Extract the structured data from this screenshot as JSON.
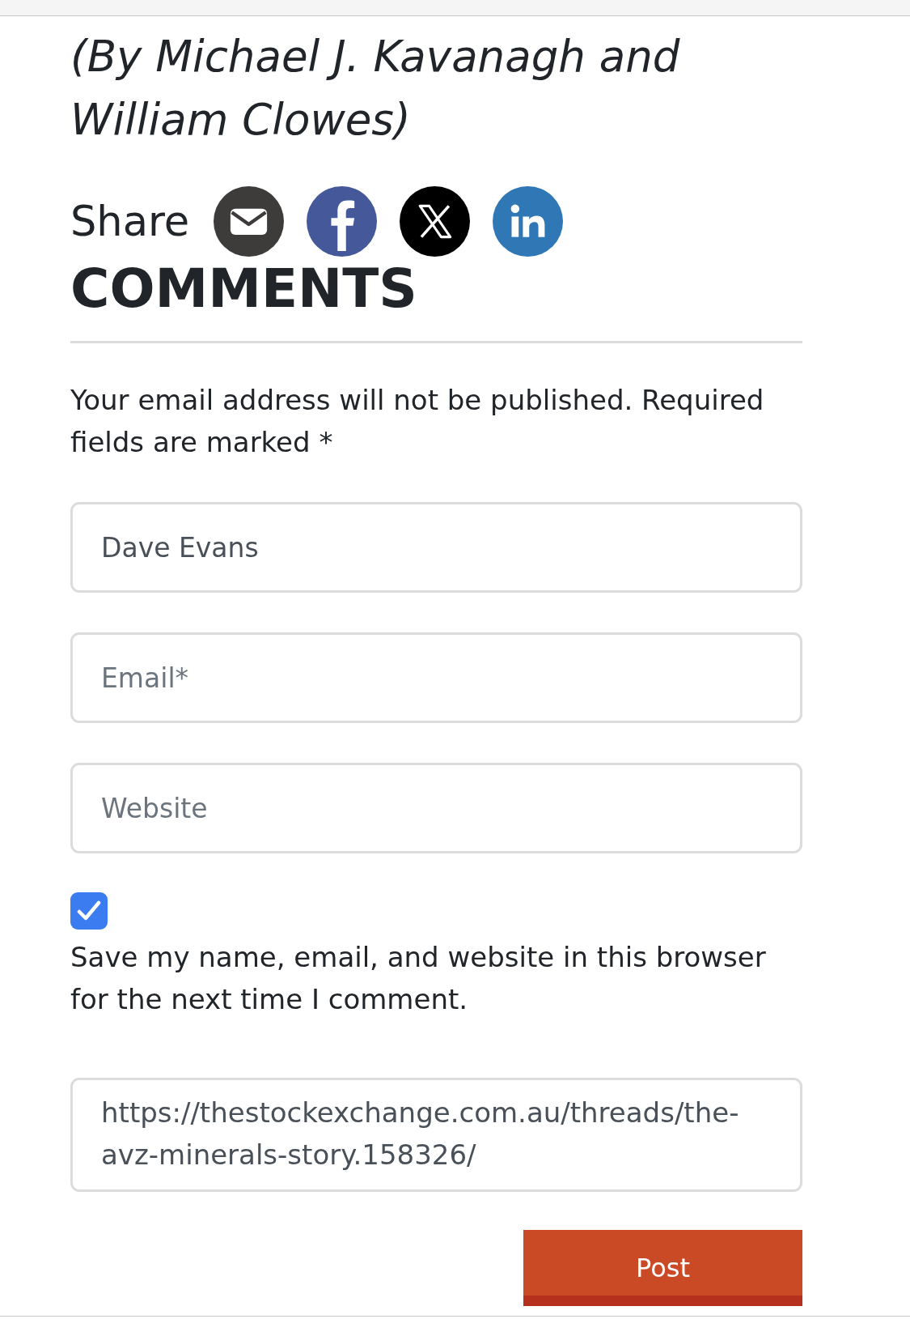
{
  "byline": "(By Michael J. Kavanagh and William Clowes)",
  "share": {
    "label": "Share",
    "buttons": [
      {
        "kind": "email"
      },
      {
        "kind": "facebook"
      },
      {
        "kind": "x"
      },
      {
        "kind": "linkedin"
      }
    ]
  },
  "comments": {
    "title": "COMMENTS",
    "notice": "Your email address will not be published. Required fields are marked *",
    "fields": [
      {
        "value": "Dave Evans"
      },
      {
        "placeholder": "Email*"
      },
      {
        "placeholder": "Website"
      }
    ],
    "consent": {
      "checked": true,
      "label": "Save my name, email, and website in this browser for the next time I comment."
    },
    "comment": {
      "value": "https://thestockexchange.com.au/threads/the-avz-minerals-story.158326/"
    },
    "submit": "Post"
  }
}
